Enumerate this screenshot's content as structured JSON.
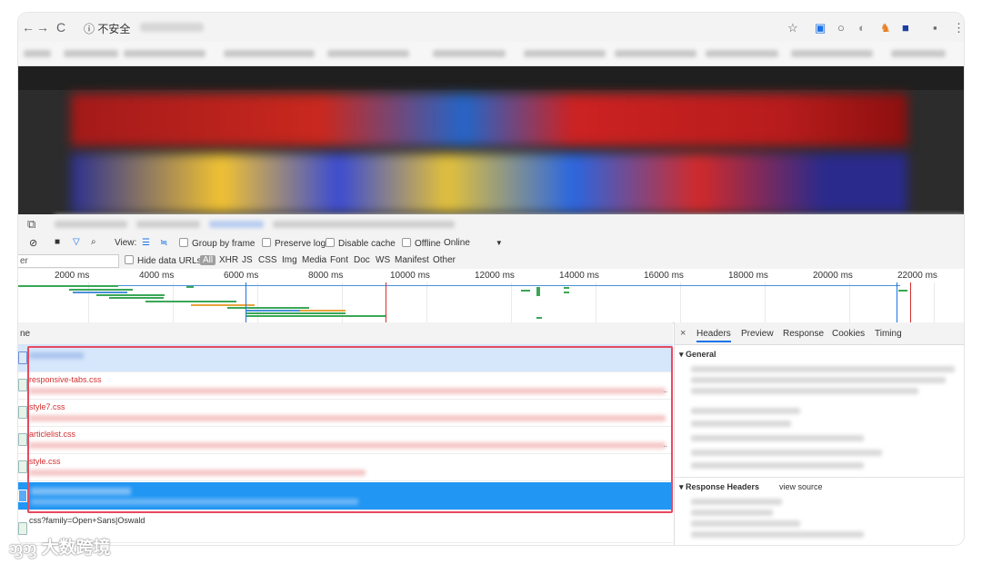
{
  "browser": {
    "nav_back": "←",
    "nav_forward": "→",
    "nav_reload": "C",
    "info_icon": "ⓘ",
    "security_label": "不安全",
    "star_icon": "☆"
  },
  "toolbar": {
    "view_label": "View:",
    "group_by_frame": "Group by frame",
    "preserve_log": "Preserve log",
    "disable_cache": "Disable cache",
    "offline": "Offline",
    "throttle": "Online",
    "throttle_arrow": "▼"
  },
  "filterbar": {
    "filter_value": "er",
    "hide_data_urls": "Hide data URLs",
    "types": [
      "All",
      "XHR",
      "JS",
      "CSS",
      "Img",
      "Media",
      "Font",
      "Doc",
      "WS",
      "Manifest",
      "Other"
    ]
  },
  "timeline": {
    "ticks": [
      "2000 ms",
      "4000 ms",
      "6000 ms",
      "8000 ms",
      "10000 ms",
      "12000 ms",
      "14000 ms",
      "16000 ms",
      "18000 ms",
      "20000 ms",
      "22000 ms"
    ]
  },
  "table": {
    "header": "ne",
    "rows": [
      {
        "name": "responsive-tabs.css"
      },
      {
        "name": "style7.css"
      },
      {
        "name": "articlelist.css"
      },
      {
        "name": "style.css"
      }
    ],
    "last_row": "css?family=Open+Sans|Oswald",
    "more": ".."
  },
  "details": {
    "close": "×",
    "tabs": [
      "Headers",
      "Preview",
      "Response",
      "Cookies",
      "Timing"
    ],
    "general": "▾ General",
    "response_headers": "▾ Response Headers",
    "view_source": "view source"
  },
  "watermark": "大数跨境",
  "colors": {
    "accent": "#1a73e8",
    "selected_row": "#2196f3",
    "error_text": "#d32f2f",
    "highlight_border": "#e64a5f"
  }
}
